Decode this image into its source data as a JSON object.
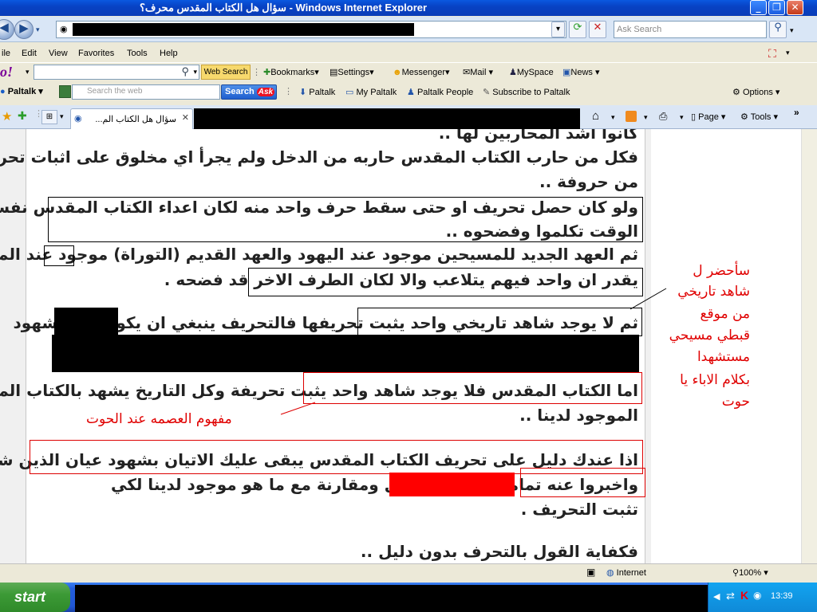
{
  "window": {
    "title": "سؤال هل الكتاب المقدس محرف؟ - Windows Internet Explorer",
    "min": "_",
    "max": "❐",
    "close": "✕"
  },
  "address": {
    "search_placeholder": "Ask Search"
  },
  "menubar": {
    "items": [
      "ile",
      "Edit",
      "View",
      "Favorites",
      "Tools",
      "Help"
    ]
  },
  "yahoo_toolbar": {
    "logo": "o!",
    "web_search": "Web Search",
    "bookmarks": "Bookmarks",
    "settings": "Settings",
    "messenger": "Messenger",
    "mail": "Mail",
    "myspace": "MySpace",
    "news": "News"
  },
  "paltalk_toolbar": {
    "brand": "Paltalk",
    "search_placeholder": "Search the web",
    "search_button": "Search",
    "ask": "Ask",
    "links": [
      "Paltalk",
      "My Paltalk",
      "Paltalk People",
      "Subscribe to Paltalk"
    ],
    "options": "Options"
  },
  "tabs": {
    "active_label": "سؤال هل الكتاب الم...",
    "page": "Page",
    "tools": "Tools"
  },
  "content": {
    "lines": [
      "كانوا اشد المحاربين لها ..",
      "فكل من حارب الكتاب المقدس حاربه من الدخل ولم يجرأ اي مخلوق على اثبات تحرف حرف واحد",
      "من حروفة ..",
      "ولو كان حصل تحريف او حتى سقط حرف واحد منه لكان اعداء الكتاب المقدس نفسه في ذلك",
      "الوقت تكلموا وفضحوه ..",
      "ثم العهد الجديد للمسيحين موجود عند اليهود والعهد القديم (التوراة) موجود عند المسيحين ولا",
      "يقدر ان واحد فيهم يتلاعب والا لكان الطرف الاخر قد فضحه .",
      "ثم لا يوجد شاهد تاريخي واحد يثبت تحريفها فالتحريف ينبغي ان يكون عليه شهود",
      "اما الكتاب المقدس فلا يوجد شاهد واحد يثبت تحريفة وكل التاريخ يشهد بالكتاب المقدس نفسه",
      "الموجود لدينا ..",
      "اذا عندك دليل على تحريف الكتاب المقدس يبقى عليك الاتيان بشهود عيان الذين شهدوا التحريف",
      "واخبروا عنه تماما",
      "او الاتيان بالاصل ومقارنة مع ما هو موجود لدينا لكي",
      "تثبت التحريف .",
      "فكفاية القول بالتحرف بدون دليل .."
    ],
    "annotation_right": [
      "سأحضر ل",
      "شاهد تاريخي",
      "من موقع",
      "قبطي مسيحي",
      "مستشهدا",
      "بكلام الاباء يا",
      "حوت"
    ],
    "annotation_left": "مفهوم العصمه عند الحوت"
  },
  "status": {
    "zone": "Internet",
    "zoom": "100%"
  },
  "taskbar": {
    "start": "start",
    "clock": "13:39"
  }
}
